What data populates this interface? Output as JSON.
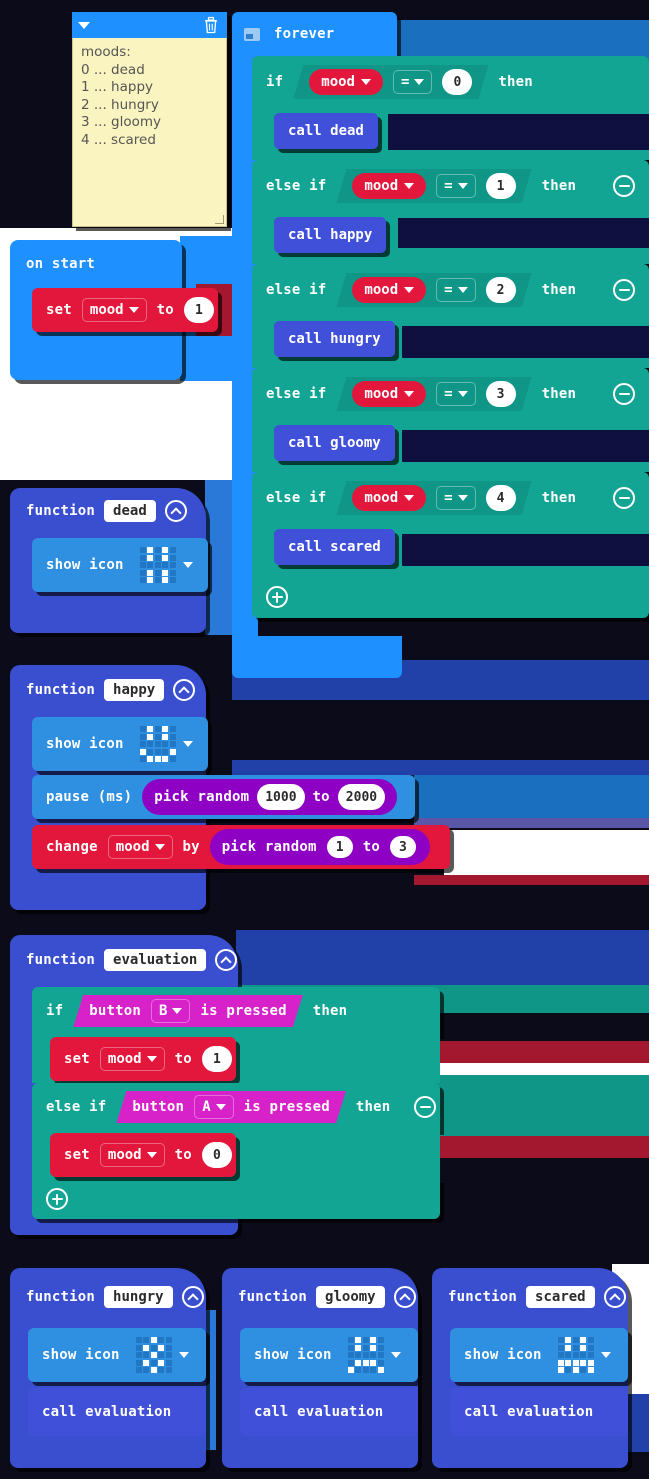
{
  "app": {
    "name": "MakeCode Blocks Editor",
    "background_color": "#0b0b1a"
  },
  "palette": {
    "loop_blue": "#1e90ff",
    "logic_teal": "#12a594",
    "variable_red": "#e3173b",
    "function_indigo": "#4050d8",
    "basic_blue": "#2f8fe0",
    "math_purple": "#8e00c4",
    "input_magenta": "#d622c8",
    "comment_yellow": "#faf4c0"
  },
  "comment": {
    "icon_collapse": "chevron-down-icon",
    "icon_delete": "trash-icon",
    "lines": [
      "moods:",
      "0 ... dead",
      "1 ... happy",
      "2 ... hungry",
      "3 ... gloomy",
      "4 ... scared"
    ]
  },
  "forever": {
    "icon": "screen-icon",
    "label": "forever",
    "add_branch_icon": "plus-circle-icon",
    "branches": [
      {
        "keyword": "if",
        "variable": "mood",
        "operator": "=",
        "value": "0",
        "then": "then",
        "remove": false,
        "body_call": "call dead"
      },
      {
        "keyword": "else if",
        "variable": "mood",
        "operator": "=",
        "value": "1",
        "then": "then",
        "remove": true,
        "body_call": "call happy"
      },
      {
        "keyword": "else if",
        "variable": "mood",
        "operator": "=",
        "value": "2",
        "then": "then",
        "remove": true,
        "body_call": "call hungry"
      },
      {
        "keyword": "else if",
        "variable": "mood",
        "operator": "=",
        "value": "3",
        "then": "then",
        "remove": true,
        "body_call": "call gloomy"
      },
      {
        "keyword": "else if",
        "variable": "mood",
        "operator": "=",
        "value": "4",
        "then": "then",
        "remove": true,
        "body_call": "call scared"
      }
    ]
  },
  "on_start": {
    "label": "on start",
    "set_label": "set",
    "variable": "mood",
    "to_label": "to",
    "value": "1"
  },
  "functions": [
    {
      "title": "function",
      "name": "dead",
      "collapse_icon": "chevron-up-circle-icon",
      "show_icon_label": "show icon",
      "led": [
        "01010",
        "01010",
        "00000",
        "01010",
        "01010"
      ],
      "dropdown_icon": "chevron-down-icon"
    },
    {
      "title": "function",
      "name": "happy",
      "collapse_icon": "chevron-up-circle-icon",
      "show_icon_label": "show icon",
      "led": [
        "01010",
        "01010",
        "00000",
        "10001",
        "01110"
      ],
      "dropdown_icon": "chevron-down-icon",
      "pause_label": "pause (ms)",
      "pause_random": {
        "label": "pick random",
        "from": "1000",
        "to_label": "to",
        "to": "2000"
      },
      "change_label": "change",
      "change_variable": "mood",
      "by_label": "by",
      "change_random": {
        "label": "pick random",
        "from": "1",
        "to_label": "to",
        "to": "3"
      }
    },
    {
      "title": "function",
      "name": "evaluation",
      "collapse_icon": "chevron-up-circle-icon",
      "add_branch_icon": "plus-circle-icon",
      "branches": [
        {
          "keyword": "if",
          "button_label": "button",
          "button": "B",
          "pressed_label": "is pressed",
          "then": "then",
          "remove": false,
          "set_label": "set",
          "variable": "mood",
          "to_label": "to",
          "value": "1"
        },
        {
          "keyword": "else if",
          "button_label": "button",
          "button": "A",
          "pressed_label": "is pressed",
          "then": "then",
          "remove": true,
          "set_label": "set",
          "variable": "mood",
          "to_label": "to",
          "value": "0"
        }
      ]
    },
    {
      "title": "function",
      "name": "hungry",
      "collapse_icon": "chevron-up-circle-icon",
      "show_icon_label": "show icon",
      "led": [
        "00100",
        "01010",
        "00100",
        "01010",
        "00100"
      ],
      "dropdown_icon": "chevron-down-icon",
      "call_label": "call evaluation"
    },
    {
      "title": "function",
      "name": "gloomy",
      "collapse_icon": "chevron-up-circle-icon",
      "show_icon_label": "show icon",
      "led": [
        "01010",
        "01010",
        "00000",
        "01110",
        "10001"
      ],
      "dropdown_icon": "chevron-down-icon",
      "call_label": "call evaluation"
    },
    {
      "title": "function",
      "name": "scared",
      "collapse_icon": "chevron-up-circle-icon",
      "show_icon_label": "show icon",
      "led": [
        "01010",
        "01010",
        "00000",
        "11111",
        "10101"
      ],
      "dropdown_icon": "chevron-down-icon",
      "call_label": "call evaluation"
    }
  ]
}
